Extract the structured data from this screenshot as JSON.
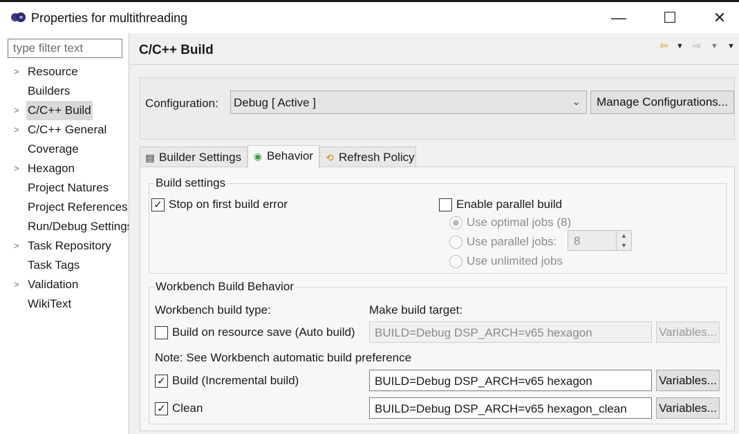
{
  "window": {
    "title": "Properties for multithreading",
    "minimize": "—",
    "maximize": "☐",
    "close": "✕"
  },
  "sidebar": {
    "filter_placeholder": "type filter text",
    "items": [
      {
        "label": "Resource",
        "expandable": true
      },
      {
        "label": "Builders",
        "expandable": false
      },
      {
        "label": "C/C++ Build",
        "expandable": true,
        "selected": true
      },
      {
        "label": "C/C++ General",
        "expandable": true
      },
      {
        "label": "Coverage",
        "expandable": false
      },
      {
        "label": "Hexagon",
        "expandable": true
      },
      {
        "label": "Project Natures",
        "expandable": false
      },
      {
        "label": "Project References",
        "expandable": false
      },
      {
        "label": "Run/Debug Settings",
        "expandable": false
      },
      {
        "label": "Task Repository",
        "expandable": true
      },
      {
        "label": "Task Tags",
        "expandable": false
      },
      {
        "label": "Validation",
        "expandable": true
      },
      {
        "label": "WikiText",
        "expandable": false
      }
    ]
  },
  "page": {
    "title": "C/C++ Build"
  },
  "configuration": {
    "label": "Configuration:",
    "value": "Debug  [ Active ]",
    "manage_button": "Manage Configurations..."
  },
  "tabs": [
    {
      "label": "Builder Settings",
      "icon": "document-icon"
    },
    {
      "label": "Behavior",
      "icon": "radio-icon",
      "active": true
    },
    {
      "label": "Refresh Policy",
      "icon": "refresh-icon"
    }
  ],
  "build_settings": {
    "title": "Build settings",
    "stop_on_first_error": {
      "label": "Stop on first build error",
      "checked": true
    },
    "enable_parallel": {
      "label": "Enable parallel build",
      "checked": false
    },
    "use_optimal_jobs": {
      "label": "Use optimal jobs (8)",
      "selected": true,
      "enabled": false
    },
    "use_parallel_jobs": {
      "label": "Use parallel jobs:",
      "selected": false,
      "enabled": false,
      "value": "8"
    },
    "use_unlimited_jobs": {
      "label": "Use unlimited jobs",
      "selected": false,
      "enabled": false
    }
  },
  "workbench": {
    "title": "Workbench Build Behavior",
    "build_type_label": "Workbench build type:",
    "make_target_label": "Make build target:",
    "auto_build": {
      "label": "Build on resource save (Auto build)",
      "checked": false,
      "target": "BUILD=Debug DSP_ARCH=v65 hexagon",
      "enabled": false
    },
    "note": "Note: See Workbench automatic build preference",
    "incremental": {
      "label": "Build (Incremental build)",
      "checked": true,
      "target": "BUILD=Debug DSP_ARCH=v65 hexagon"
    },
    "clean": {
      "label": "Clean",
      "checked": true,
      "target": "BUILD=Debug DSP_ARCH=v65 hexagon_clean"
    },
    "variables_label": "Variables..."
  }
}
